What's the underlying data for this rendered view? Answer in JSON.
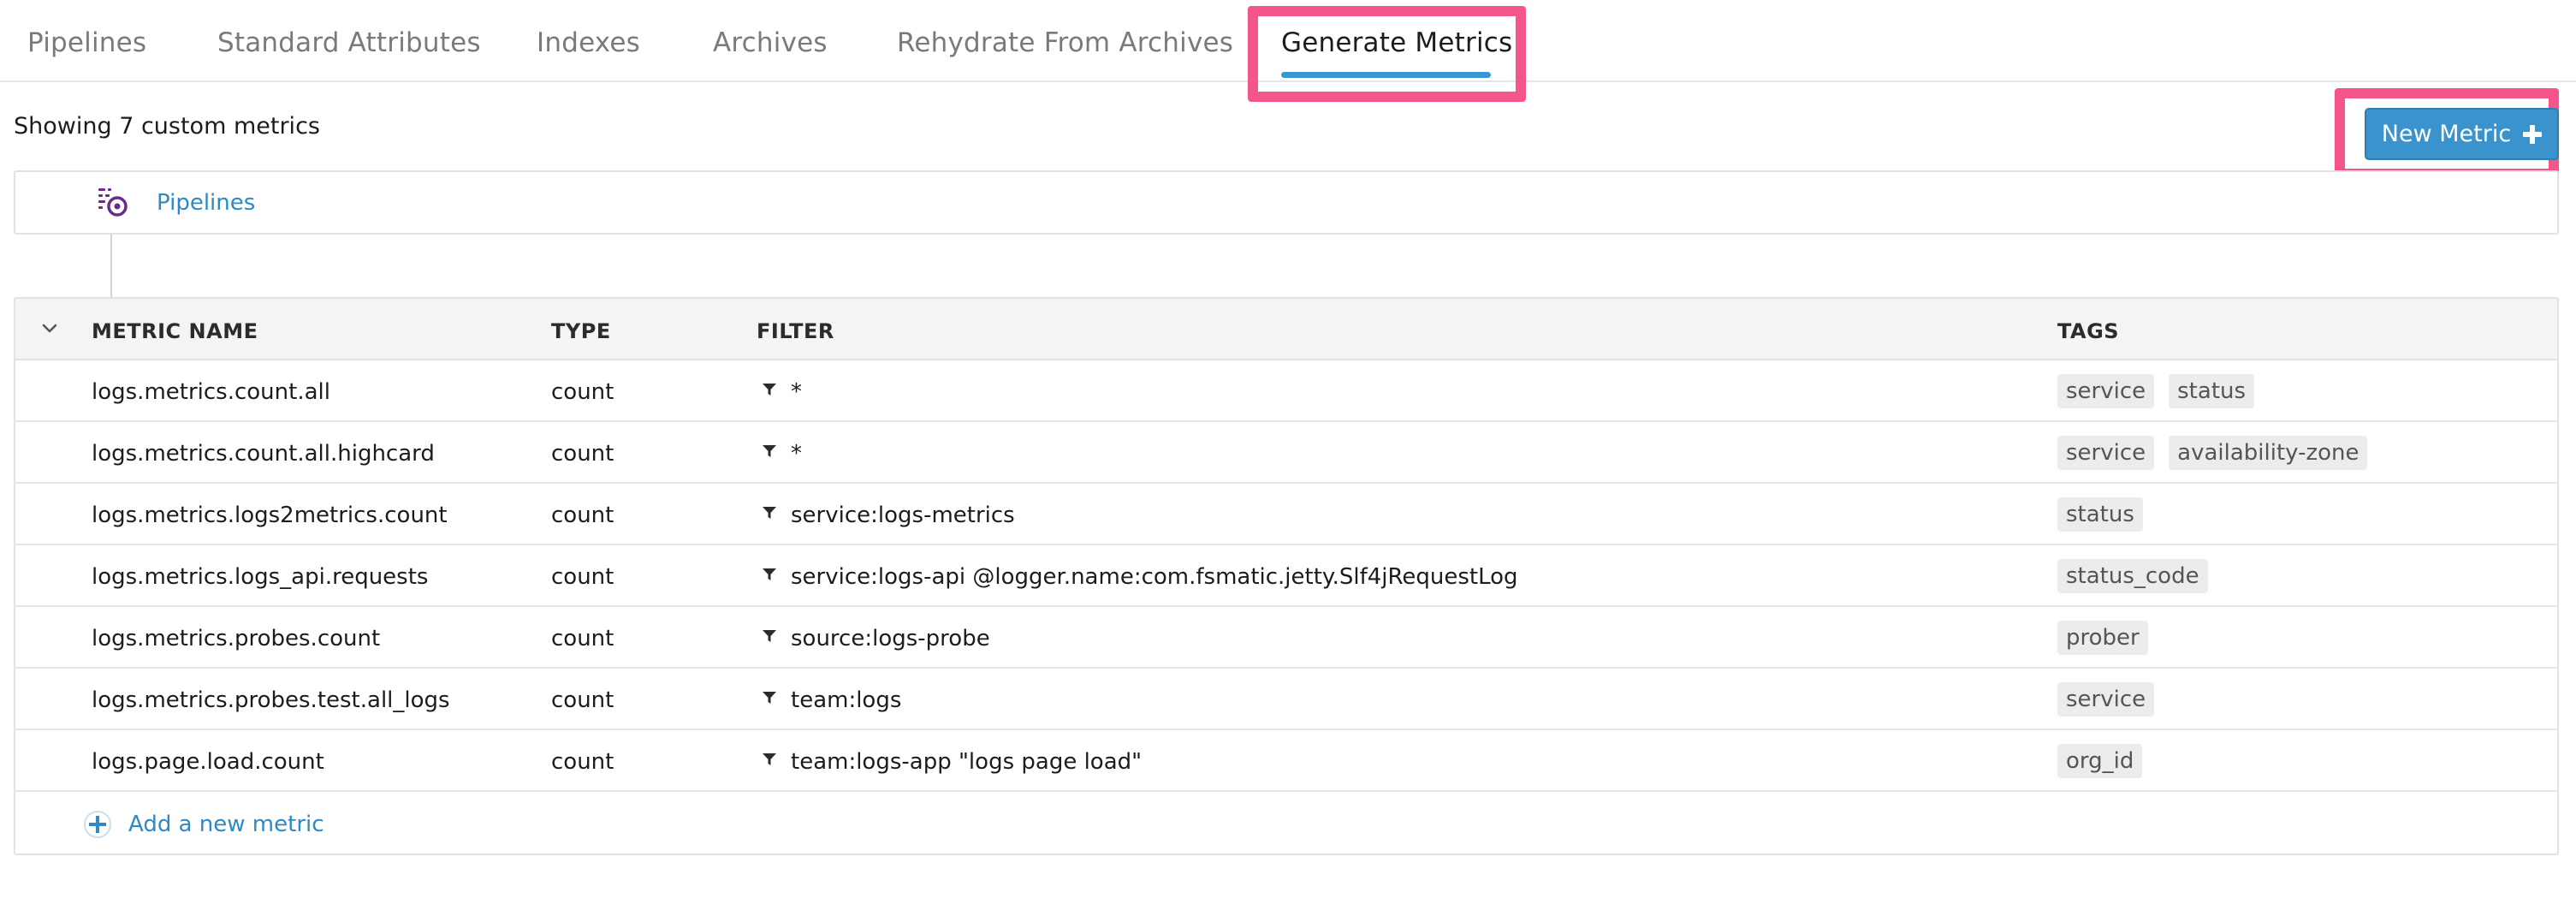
{
  "tabs": [
    {
      "label": "Pipelines",
      "active": false
    },
    {
      "label": "Standard Attributes",
      "active": false
    },
    {
      "label": "Indexes",
      "active": false
    },
    {
      "label": "Archives",
      "active": false
    },
    {
      "label": "Rehydrate From Archives",
      "active": false
    },
    {
      "label": "Generate Metrics",
      "active": true
    }
  ],
  "summary": "Showing 7 custom metrics",
  "new_button": {
    "label": "New Metric",
    "icon": "plus-icon"
  },
  "breadcrumb": {
    "icon": "pipelines-icon",
    "label": "Pipelines"
  },
  "table": {
    "columns": [
      "METRIC NAME",
      "TYPE",
      "FILTER",
      "TAGS"
    ],
    "rows": [
      {
        "name": "logs.metrics.count.all",
        "type": "count",
        "filter": "*",
        "tags": [
          "service",
          "status"
        ]
      },
      {
        "name": "logs.metrics.count.all.highcard",
        "type": "count",
        "filter": "*",
        "tags": [
          "service",
          "availability-zone"
        ]
      },
      {
        "name": "logs.metrics.logs2metrics.count",
        "type": "count",
        "filter": "service:logs-metrics",
        "tags": [
          "status"
        ]
      },
      {
        "name": "logs.metrics.logs_api.requests",
        "type": "count",
        "filter": "service:logs-api @logger.name:com.fsmatic.jetty.Slf4jRequestLog",
        "tags": [
          "status_code"
        ]
      },
      {
        "name": "logs.metrics.probes.count",
        "type": "count",
        "filter": "source:logs-probe",
        "tags": [
          "prober"
        ]
      },
      {
        "name": "logs.metrics.probes.test.all_logs",
        "type": "count",
        "filter": "team:logs",
        "tags": [
          "service"
        ]
      },
      {
        "name": "logs.page.load.count",
        "type": "count",
        "filter": "team:logs-app \"logs page load\"",
        "tags": [
          "org_id"
        ]
      }
    ],
    "add_label": "Add a new metric"
  },
  "colors": {
    "accent": "#3a96d2",
    "highlight": "#f4558b",
    "link": "#2e8ac4",
    "icon_purple": "#6a2b8c"
  }
}
